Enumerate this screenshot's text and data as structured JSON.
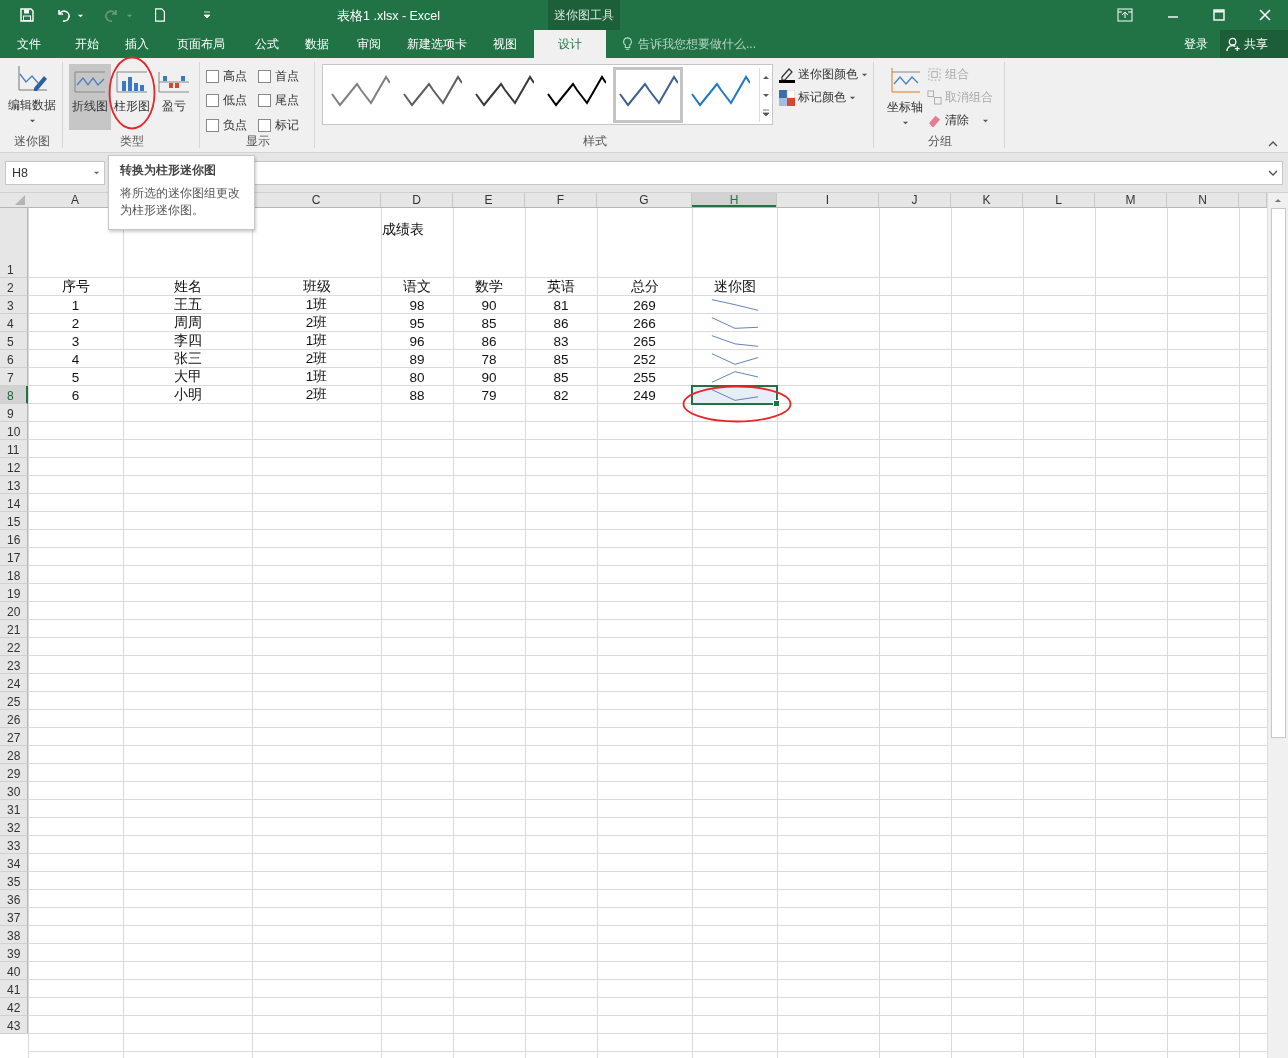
{
  "window": {
    "title": "表格1 .xlsx - Excel",
    "context_tab": "迷你图工具"
  },
  "menu_tabs": [
    {
      "label": "文件",
      "selected": false
    },
    {
      "label": "开始",
      "selected": false
    },
    {
      "label": "插入",
      "selected": false
    },
    {
      "label": "页面布局",
      "selected": false
    },
    {
      "label": "公式",
      "selected": false
    },
    {
      "label": "数据",
      "selected": false
    },
    {
      "label": "审阅",
      "selected": false
    },
    {
      "label": "新建选项卡",
      "selected": false
    },
    {
      "label": "视图",
      "selected": false
    },
    {
      "label": "设计",
      "selected": true
    }
  ],
  "tell_me": {
    "placeholder": "告诉我您想要做什么..."
  },
  "sign_in": "登录",
  "share": "共享",
  "ribbon": {
    "sparkline_group": {
      "label": "迷你图",
      "edit_data": "编辑数据"
    },
    "type_group": {
      "label": "类型",
      "types": [
        {
          "kind": "line",
          "label": "折线图",
          "selected": true,
          "circled": false
        },
        {
          "kind": "column",
          "label": "柱形图",
          "selected": false,
          "circled": true
        },
        {
          "kind": "winloss",
          "label": "盈亏",
          "selected": false,
          "circled": false
        }
      ]
    },
    "show_group": {
      "label": "显示",
      "options": [
        {
          "label": "高点",
          "checked": false
        },
        {
          "label": "首点",
          "checked": false
        },
        {
          "label": "低点",
          "checked": false
        },
        {
          "label": "尾点",
          "checked": false
        },
        {
          "label": "负点",
          "checked": false
        },
        {
          "label": "标记",
          "checked": false
        }
      ]
    },
    "style_group": {
      "label": "样式",
      "styles": [
        {
          "color": "#808080",
          "selected": false
        },
        {
          "color": "#5f5f5f",
          "selected": false
        },
        {
          "color": "#3a3a3a",
          "selected": false
        },
        {
          "color": "#000000",
          "selected": false
        },
        {
          "color": "#3f5f8f",
          "selected": true
        },
        {
          "color": "#1f78c8",
          "selected": false
        }
      ],
      "sparkline_color": "迷你图颜色",
      "marker_color": "标记颜色"
    },
    "group_group": {
      "label": "分组",
      "axis": "坐标轴",
      "group": "组合",
      "group_disabled": true,
      "ungroup": "取消组合",
      "ungroup_disabled": true,
      "clear": "清除"
    }
  },
  "tooltip": {
    "title": "转换为柱形迷你图",
    "body": "将所选的迷你图组更改为柱形迷你图。"
  },
  "name_box": "H8",
  "column_headers": [
    {
      "letter": "A",
      "selected": false
    },
    {
      "letter": "C",
      "selected": false
    },
    {
      "letter": "D",
      "selected": false
    },
    {
      "letter": "E",
      "selected": false
    },
    {
      "letter": "F",
      "selected": false
    },
    {
      "letter": "G",
      "selected": false
    },
    {
      "letter": "H",
      "selected": true
    },
    {
      "letter": "I",
      "selected": false
    },
    {
      "letter": "J",
      "selected": false
    },
    {
      "letter": "K",
      "selected": false
    },
    {
      "letter": "L",
      "selected": false
    },
    {
      "letter": "M",
      "selected": false
    },
    {
      "letter": "N",
      "selected": false
    }
  ],
  "row_numbers": [
    {
      "label": "1",
      "selected": false
    },
    {
      "label": "2",
      "selected": false
    },
    {
      "label": "3",
      "selected": false
    },
    {
      "label": "4",
      "selected": false
    },
    {
      "label": "5",
      "selected": false
    },
    {
      "label": "6",
      "selected": false
    },
    {
      "label": "7",
      "selected": false
    },
    {
      "label": "8",
      "selected": true
    },
    {
      "label": "9",
      "selected": false
    },
    {
      "label": "10",
      "selected": false
    },
    {
      "label": "11",
      "selected": false
    },
    {
      "label": "12",
      "selected": false
    },
    {
      "label": "13",
      "selected": false
    },
    {
      "label": "14",
      "selected": false
    },
    {
      "label": "15",
      "selected": false
    },
    {
      "label": "16",
      "selected": false
    },
    {
      "label": "17",
      "selected": false
    },
    {
      "label": "18",
      "selected": false
    },
    {
      "label": "19",
      "selected": false
    },
    {
      "label": "20",
      "selected": false
    },
    {
      "label": "21",
      "selected": false
    },
    {
      "label": "22",
      "selected": false
    },
    {
      "label": "23",
      "selected": false
    },
    {
      "label": "24",
      "selected": false
    },
    {
      "label": "25",
      "selected": false
    },
    {
      "label": "26",
      "selected": false
    },
    {
      "label": "27",
      "selected": false
    },
    {
      "label": "28",
      "selected": false
    },
    {
      "label": "29",
      "selected": false
    },
    {
      "label": "30",
      "selected": false
    },
    {
      "label": "31",
      "selected": false
    },
    {
      "label": "32",
      "selected": false
    },
    {
      "label": "33",
      "selected": false
    },
    {
      "label": "34",
      "selected": false
    },
    {
      "label": "35",
      "selected": false
    },
    {
      "label": "36",
      "selected": false
    },
    {
      "label": "37",
      "selected": false
    },
    {
      "label": "38",
      "selected": false
    },
    {
      "label": "39",
      "selected": false
    },
    {
      "label": "40",
      "selected": false
    },
    {
      "label": "41",
      "selected": false
    },
    {
      "label": "42",
      "selected": false
    },
    {
      "label": "43",
      "selected": false
    }
  ],
  "sheet_title": "成绩表",
  "table_header": [
    "序号",
    "姓名",
    "班级",
    "语文",
    "数学",
    "英语",
    "总分",
    "迷你图"
  ],
  "rows": [
    {
      "cells": [
        "1",
        "王五",
        "1班",
        "98",
        "90",
        "81",
        "269"
      ],
      "selected": false,
      "circled": false
    },
    {
      "cells": [
        "2",
        "周周",
        "2班",
        "95",
        "85",
        "86",
        "266"
      ],
      "selected": false,
      "circled": false
    },
    {
      "cells": [
        "3",
        "李四",
        "1班",
        "96",
        "86",
        "83",
        "265"
      ],
      "selected": false,
      "circled": false
    },
    {
      "cells": [
        "4",
        "张三",
        "2班",
        "89",
        "78",
        "85",
        "252"
      ],
      "selected": false,
      "circled": false
    },
    {
      "cells": [
        "5",
        "大甲",
        "1班",
        "80",
        "90",
        "85",
        "255"
      ],
      "selected": false,
      "circled": false
    },
    {
      "cells": [
        "6",
        "小明",
        "2班",
        "88",
        "79",
        "82",
        "249"
      ],
      "selected": true,
      "circled": true
    }
  ]
}
